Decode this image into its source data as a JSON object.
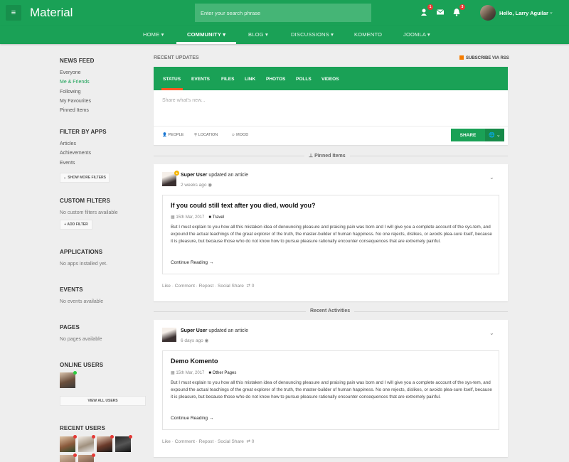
{
  "header": {
    "brand": "Material",
    "search_placeholder": "Enter your search phrase",
    "friend_badge": "1",
    "notif_badge": "3",
    "user_name": "Hello, Larry Aguilar"
  },
  "nav": {
    "items": [
      "HOME",
      "COMMUNITY",
      "BLOG",
      "DISCUSSIONS",
      "KOMENTO",
      "JOOMLA"
    ]
  },
  "sidebar": {
    "news_feed": {
      "title": "NEWS FEED",
      "items": [
        "Everyone",
        "Me & Friends",
        "Following",
        "My Favourites",
        "Pinned Items"
      ]
    },
    "filter_by_apps": {
      "title": "FILTER BY APPS",
      "items": [
        "Articles",
        "Achievements",
        "Events"
      ],
      "button": "SHOW MORE FILTERS"
    },
    "custom_filters": {
      "title": "CUSTOM FILTERS",
      "empty": "No custom filters available",
      "button": "+ ADD FILTER"
    },
    "applications": {
      "title": "APPLICATIONS",
      "empty": "No apps installed yet."
    },
    "events": {
      "title": "EVENTS",
      "empty": "No events available"
    },
    "pages": {
      "title": "PAGES",
      "empty": "No pages available"
    },
    "online_users": {
      "title": "ONLINE USERS",
      "button": "VIEW ALL USERS"
    },
    "recent_users": {
      "title": "RECENT USERS"
    }
  },
  "main": {
    "heading": "RECENT UPDATES",
    "rss": "SUBSCRIBE VIA RSS",
    "composer": {
      "tabs": [
        "STATUS",
        "EVENTS",
        "FILES",
        "LINK",
        "PHOTOS",
        "POLLS",
        "VIDEOS"
      ],
      "placeholder": "Share what's new...",
      "options": [
        "PEOPLE",
        "LOCATION",
        "MOOD"
      ],
      "share_label": "SHARE"
    },
    "pinned_label": "Pinned Items",
    "recent_label": "Recent Activities",
    "posts": [
      {
        "author": "Super User",
        "action": "updated an article",
        "time": "2 weeks ago",
        "title": "If you could still text after you died, would you?",
        "date": "15th Mar, 2017",
        "category": "Travel",
        "body": "But I must explain to you how all this mistaken idea of denouncing pleasure and praising pain was born and I will give you a complete account of the sys-tem, and expound the actual teachings of the great explorer of the truth, the master-builder of human happiness. No one rejects, dislikes, or avoids plea-sure itself, because it is pleasure, but because those who do not know how to pursue pleasure rationally encounter consequences that are extremely painful.",
        "read_more": "Continue Reading →",
        "actions": "Like · Comment · Repost · Social Share",
        "repost_count": "0"
      },
      {
        "author": "Super User",
        "action": "updated an article",
        "time": "6 days ago",
        "title": "Demo Komento",
        "date": "15th Mar, 2017",
        "category": "Other Pages",
        "body": "But I must explain to you how all this mistaken idea of denouncing pleasure and praising pain was born and I will give you a complete account of the sys-tem, and expound the actual teachings of the great explorer of the truth, the master-builder of human happiness. No one rejects, dislikes, or avoids plea-sure itself, because it is pleasure, but because those who do not know how to pursue pleasure rationally encounter consequences that are extremely painful.",
        "read_more": "Continue Reading →",
        "actions": "Like · Comment · Repost · Social Share",
        "repost_count": "0"
      }
    ]
  },
  "colors": {
    "brand_green": "#1aa156",
    "tab_underline": "#ff5722",
    "badge_red": "#e53935",
    "online_green": "#2ecc40"
  }
}
